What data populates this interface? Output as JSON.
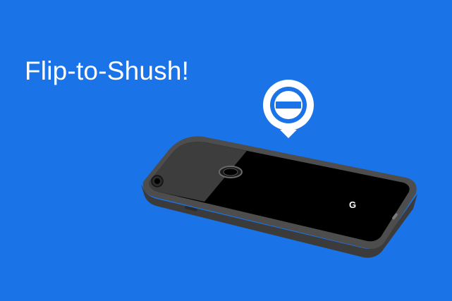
{
  "headline": "Flip-to-Shush!",
  "phone_logo": "G",
  "icons": {
    "dnd_badge": "do-not-disturb-icon",
    "camera": "camera-lens",
    "fingerprint": "fingerprint-sensor"
  },
  "colors": {
    "background": "#1b73e8",
    "phone_body": "#4a4a4a",
    "phone_back": "#000000",
    "glass_panel": "#3a3a3a",
    "badge": "#ffffff"
  }
}
